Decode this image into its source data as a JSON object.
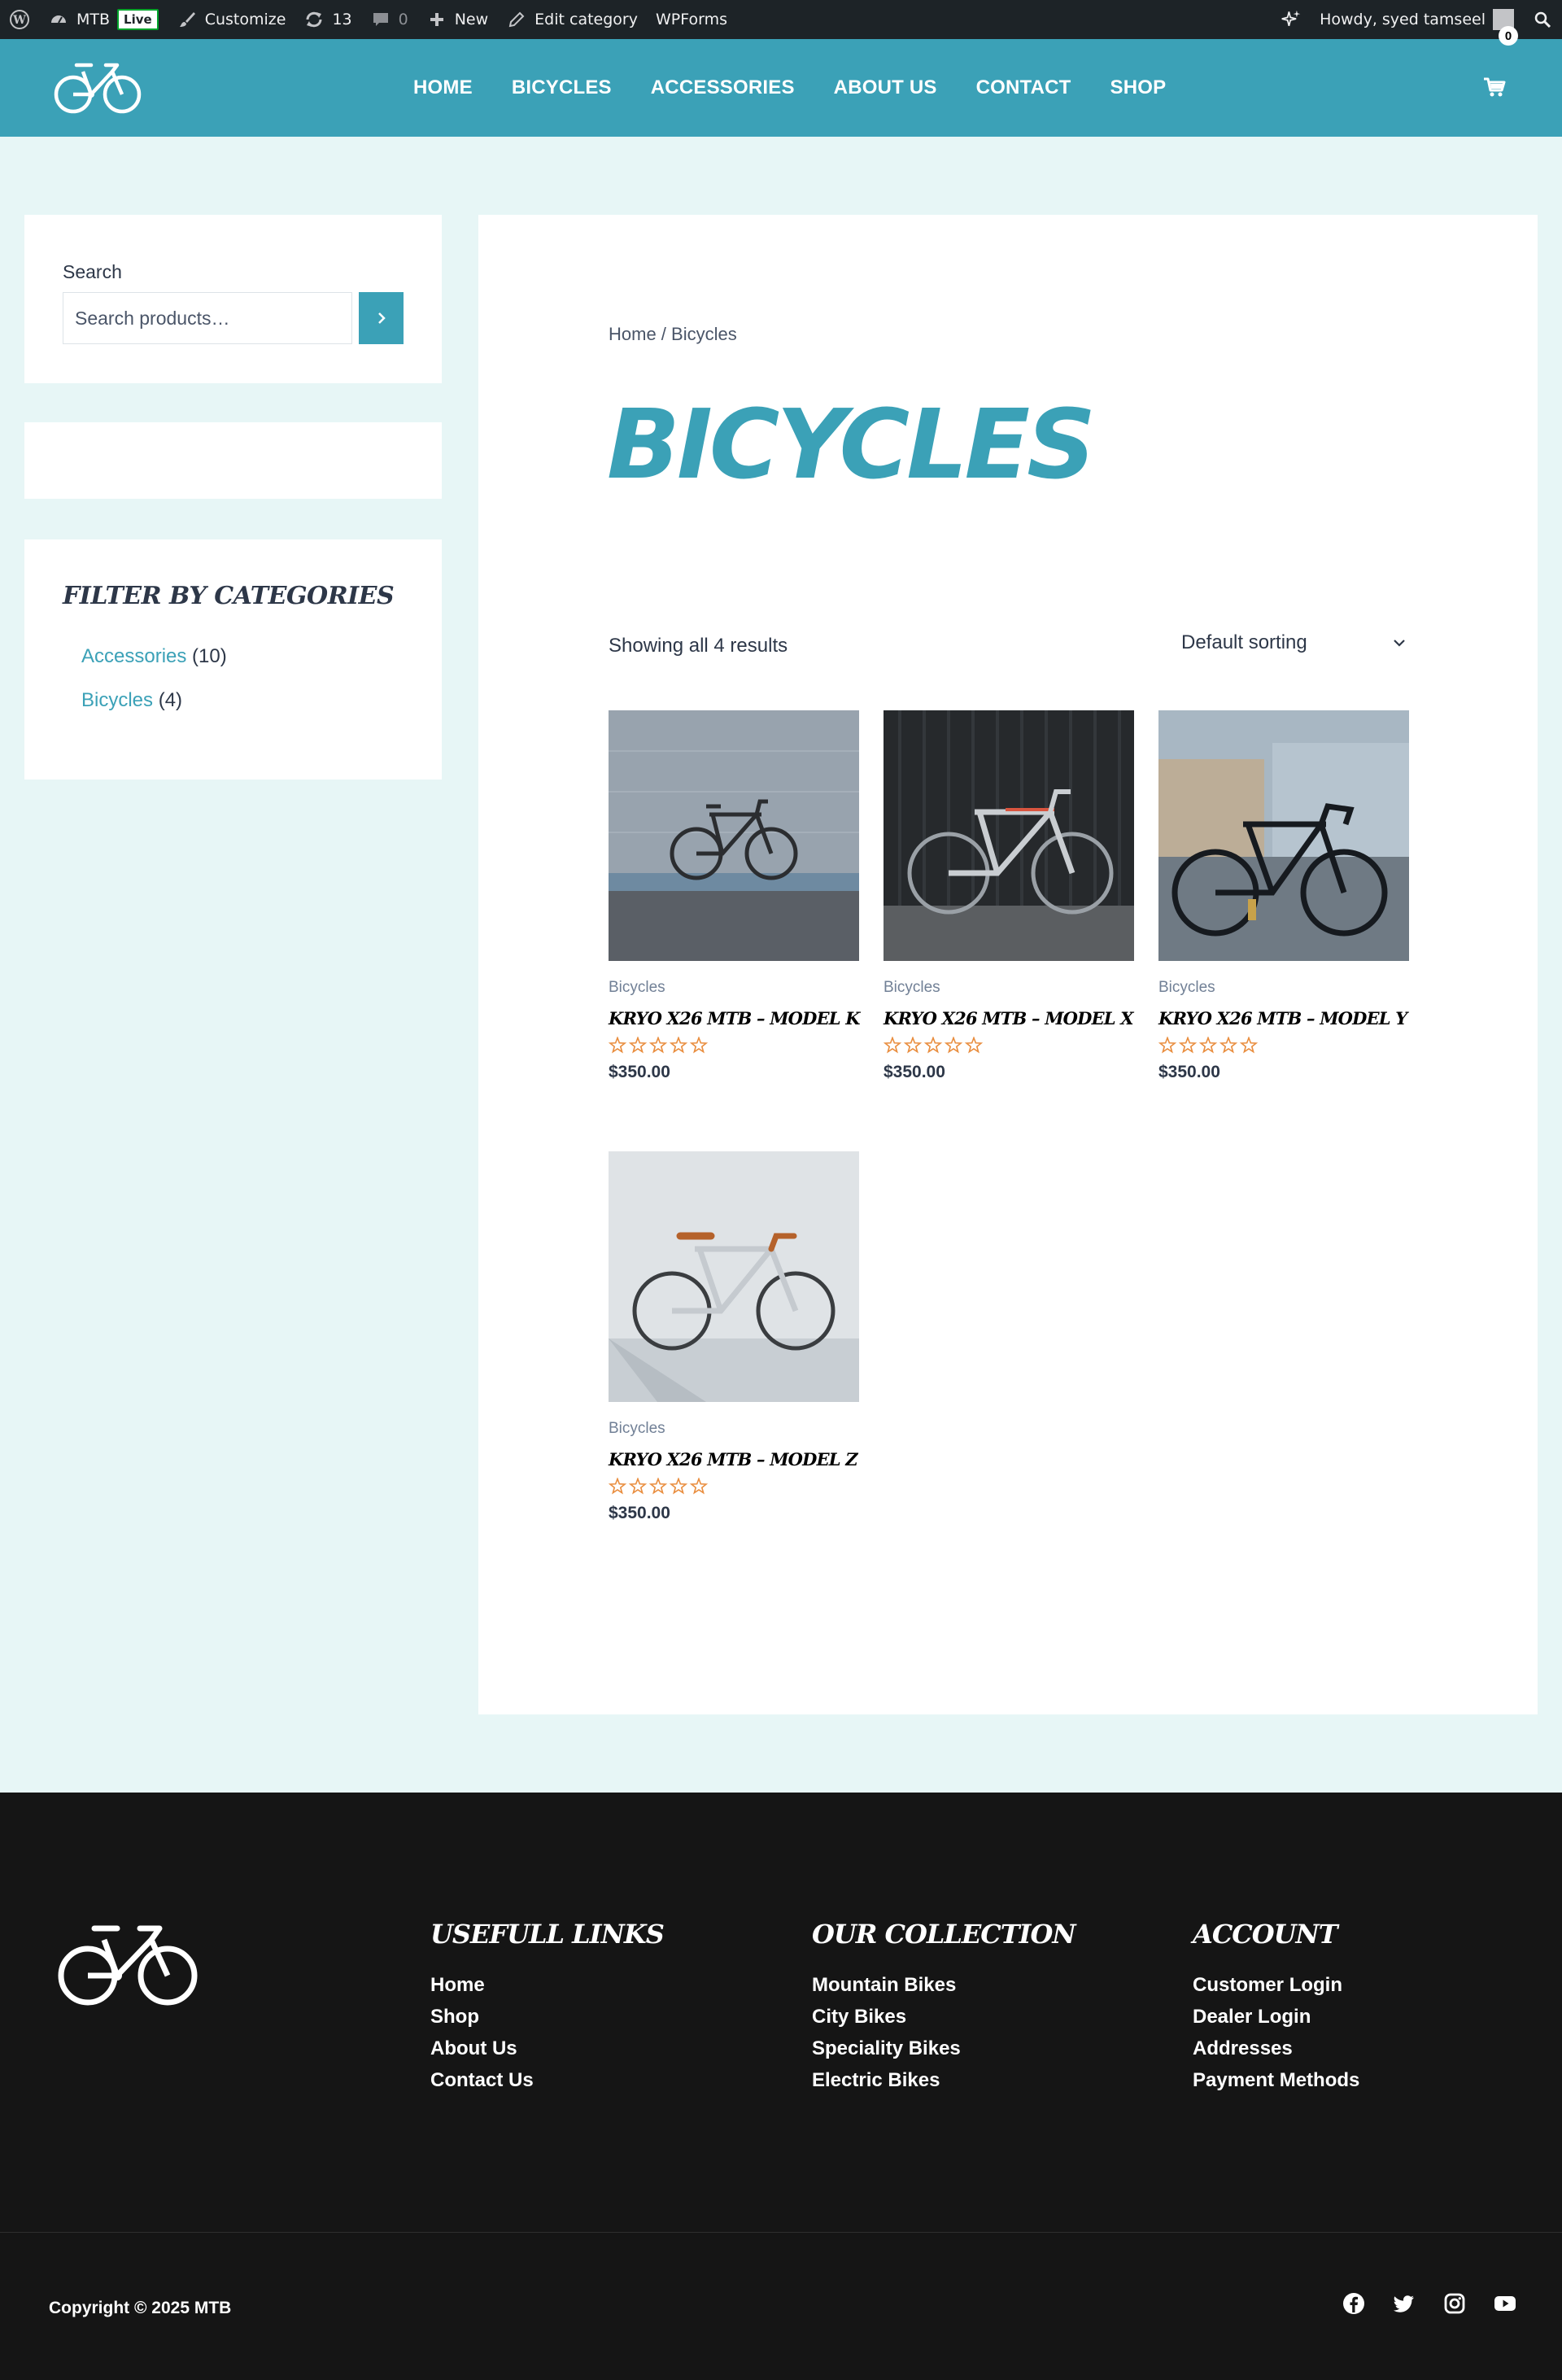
{
  "admin_bar": {
    "site_name": "MTB",
    "live_badge": "Live",
    "customize": "Customize",
    "updates_count": "13",
    "comments_count": "0",
    "new": "New",
    "edit_category": "Edit category",
    "wpforms": "WPForms",
    "howdy": "Howdy, syed tamseel"
  },
  "header": {
    "nav": [
      "HOME",
      "BICYCLES",
      "ACCESSORIES",
      "ABOUT US",
      "CONTACT",
      "SHOP"
    ],
    "cart_count": "0",
    "brand_color": "#3ba1b7"
  },
  "sidebar": {
    "search_label": "Search",
    "search_placeholder": "Search products…",
    "filter_title": "Filter by Categories",
    "categories": [
      {
        "name": "Accessories",
        "count": "(10)"
      },
      {
        "name": "Bicycles",
        "count": "(4)"
      }
    ]
  },
  "main": {
    "breadcrumb": "Home / Bicycles",
    "title": "BICYCLES",
    "result_count": "Showing all 4 results",
    "sorting": "Default sorting",
    "products": [
      {
        "category": "Bicycles",
        "title": "KRYO X26 MTB – MODEL K",
        "price": "$350.00",
        "rating": 0
      },
      {
        "category": "Bicycles",
        "title": "KRYO X26 MTB – MODEL X",
        "price": "$350.00",
        "rating": 0
      },
      {
        "category": "Bicycles",
        "title": "KRYO X26 MTB – MODEL Y",
        "price": "$350.00",
        "rating": 0
      },
      {
        "category": "Bicycles",
        "title": "KRYO X26 MTB – MODEL Z",
        "price": "$350.00",
        "rating": 0
      }
    ]
  },
  "footer": {
    "columns": [
      {
        "title": "USEFULL LINKS",
        "links": [
          "Home",
          "Shop",
          "About Us",
          "Contact Us"
        ]
      },
      {
        "title": "OUR COLLECTION",
        "links": [
          "Mountain Bikes",
          "City Bikes",
          "Speciality Bikes",
          "Electric Bikes"
        ]
      },
      {
        "title": "ACCOUNT",
        "links": [
          "Customer Login",
          "Dealer Login",
          "Addresses",
          "Payment Methods"
        ]
      }
    ],
    "copyright": "Copyright © 2025 MTB",
    "socials": [
      "facebook-icon",
      "twitter-icon",
      "instagram-icon",
      "youtube-icon"
    ]
  }
}
